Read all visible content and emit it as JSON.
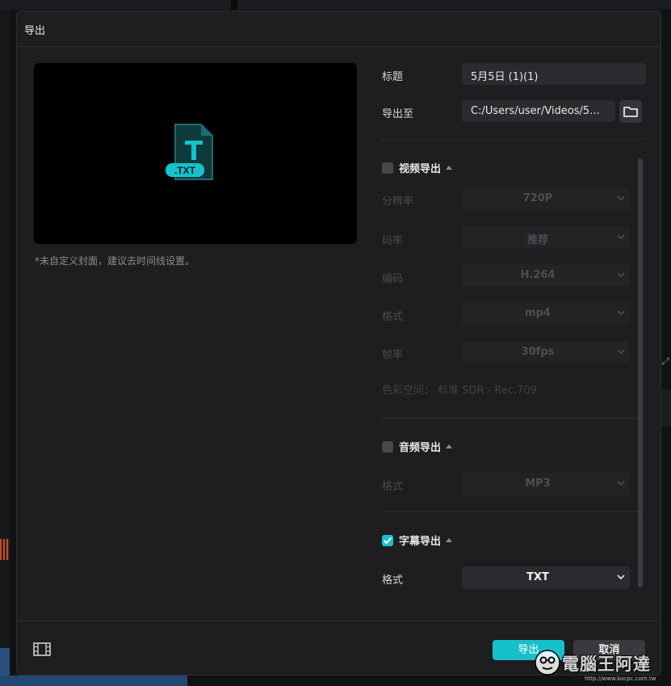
{
  "dialog": {
    "title": "导出",
    "cover_note": "*未自定义封面，建议去时间线设置。",
    "preview_badge": ".TXT"
  },
  "fields": {
    "title_label": "标题",
    "title_value": "5月5日 (1)(1)",
    "export_to_label": "导出至",
    "export_to_value": "C:/Users/user/Videos/5..."
  },
  "video_export": {
    "checked": false,
    "label": "视频导出",
    "rows": [
      {
        "label": "分辨率",
        "value": "720P"
      },
      {
        "label": "码率",
        "value": "推荐"
      },
      {
        "label": "编码",
        "value": "H.264"
      },
      {
        "label": "格式",
        "value": "mp4"
      },
      {
        "label": "帧率",
        "value": "30fps"
      }
    ],
    "color_space": "色彩空间：  标准 SDR - Rec.709"
  },
  "audio_export": {
    "checked": false,
    "label": "音频导出",
    "format_label": "格式",
    "format_value": "MP3"
  },
  "subtitle_export": {
    "checked": true,
    "label": "字幕导出",
    "format_label": "格式",
    "format_value": "TXT"
  },
  "footer": {
    "export_button": "导出",
    "cancel_button": "取消"
  },
  "watermark": {
    "text": "電腦王阿達",
    "url": "http://www.kocpc.com.tw"
  },
  "colors": {
    "accent": "#17c1cc",
    "dialog_bg": "#1e1e21",
    "field_bg": "#2b2b2f"
  }
}
